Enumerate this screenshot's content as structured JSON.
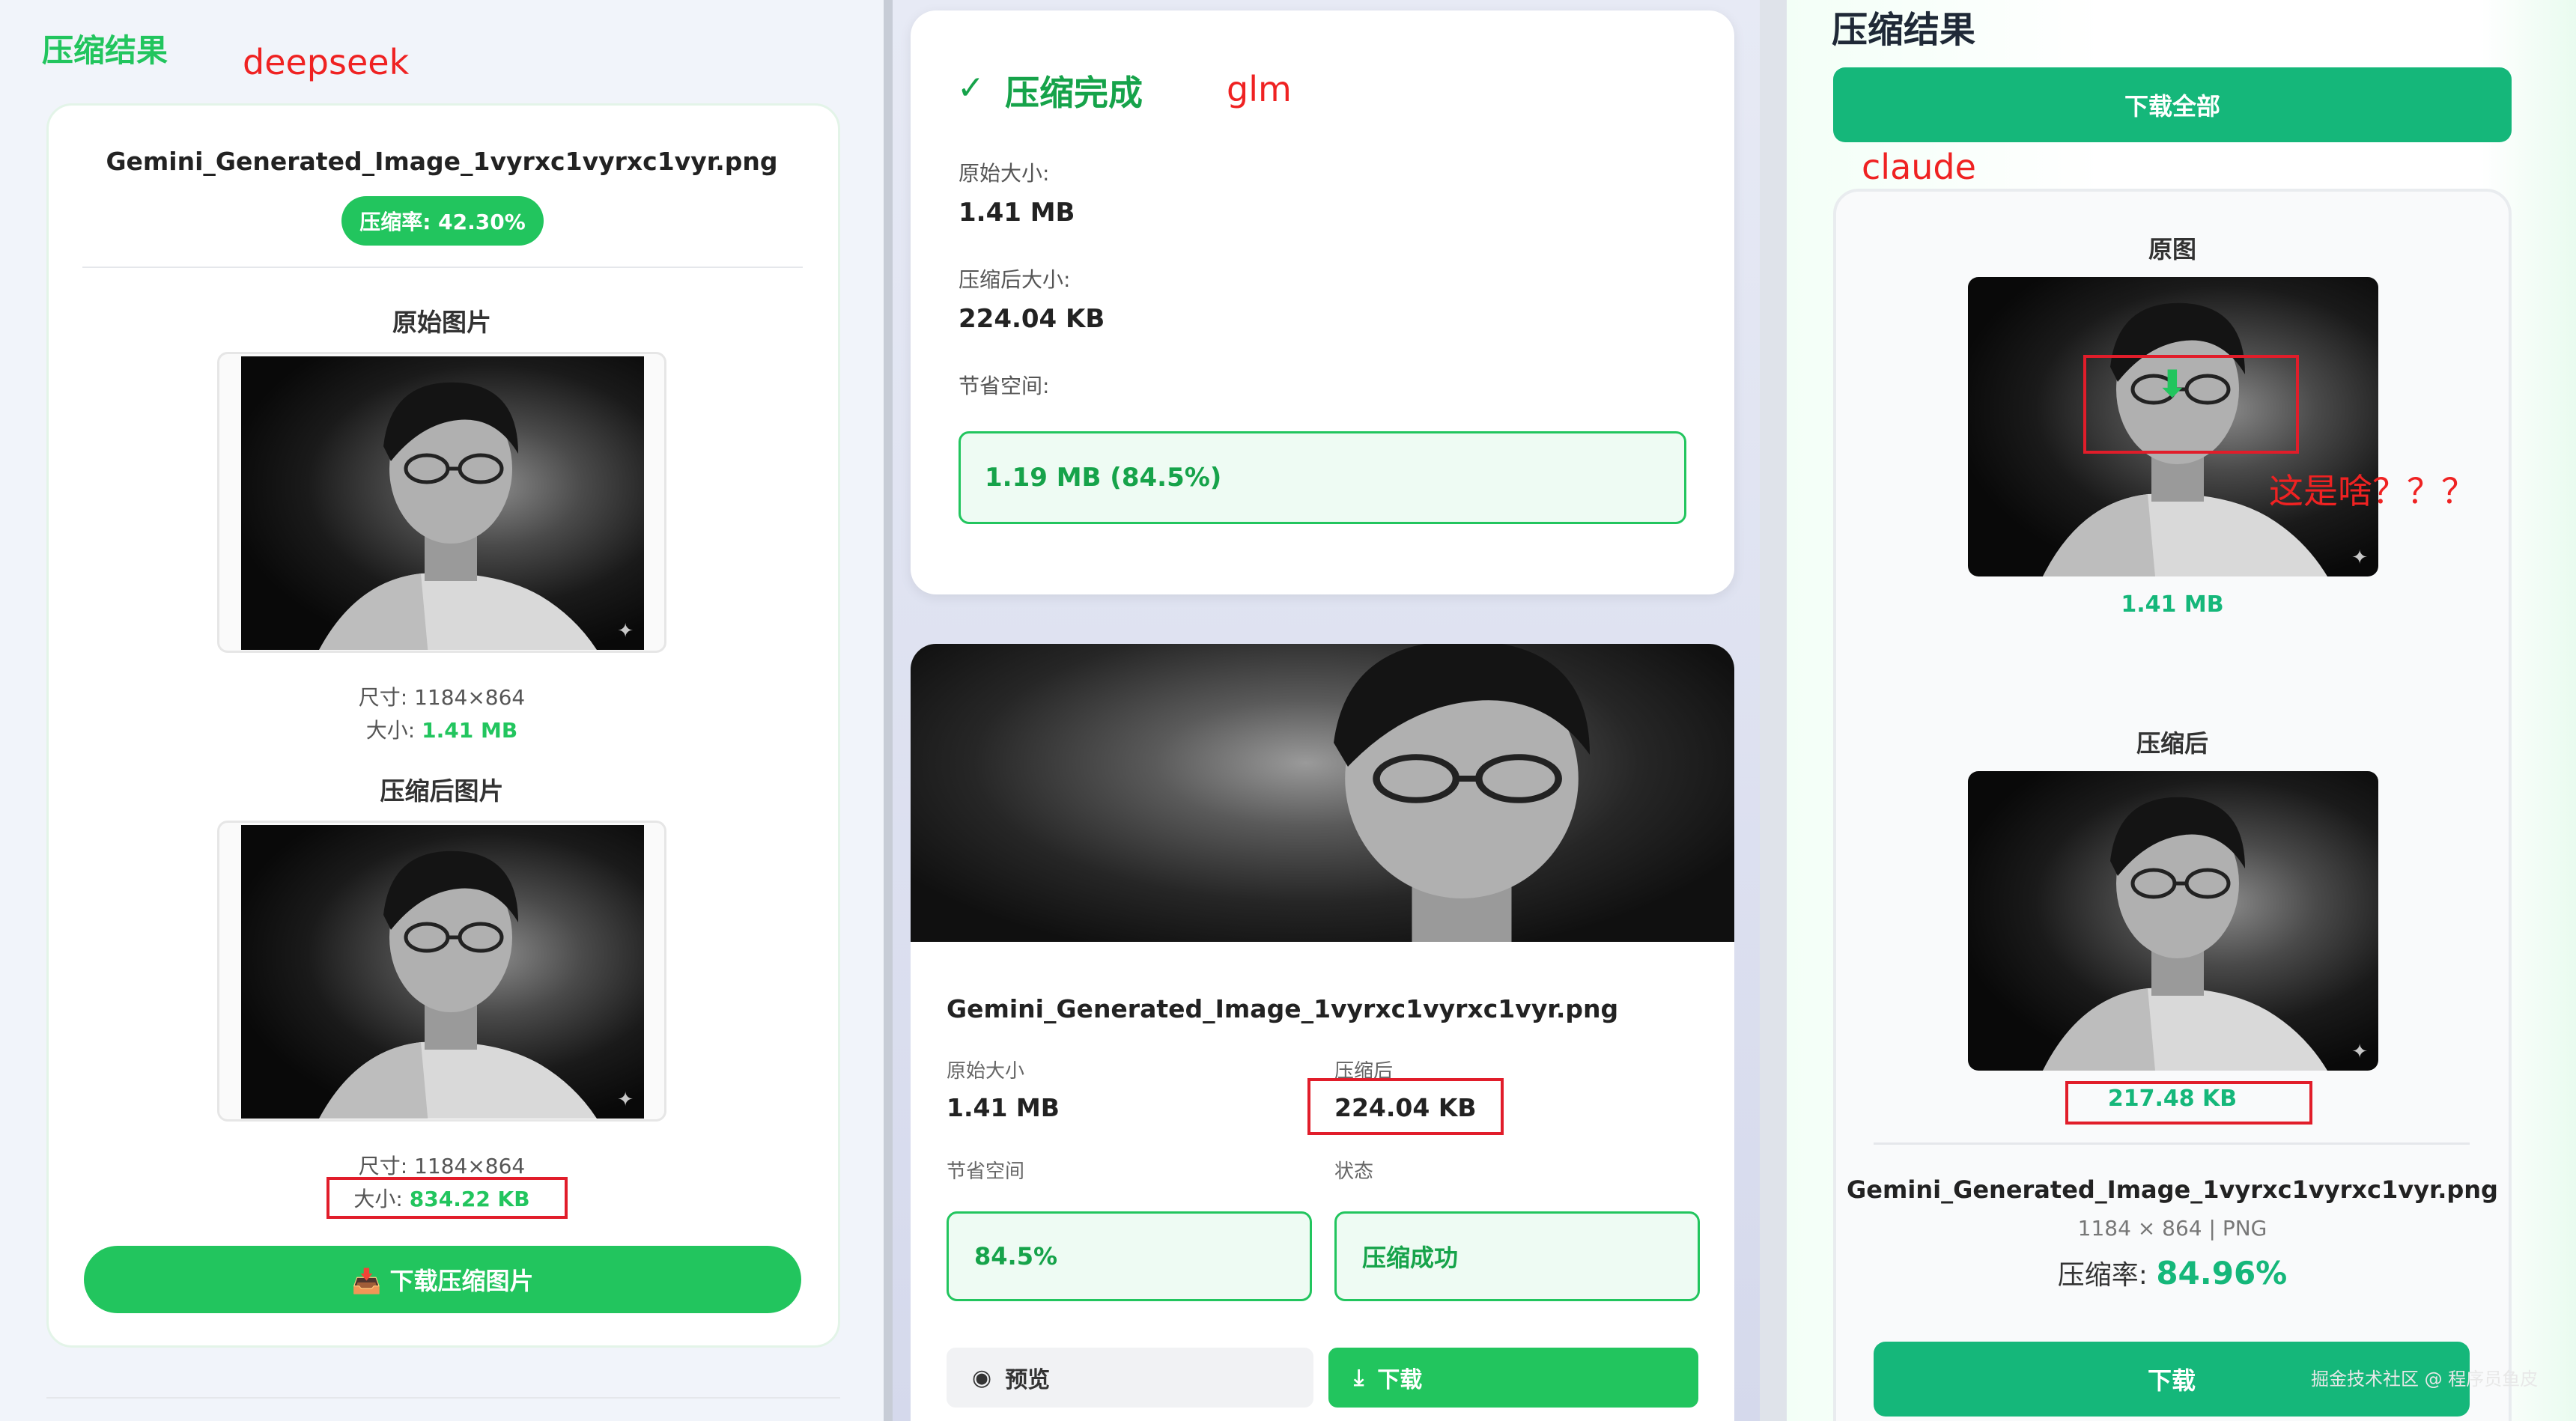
{
  "colors": {
    "accent": "#22c55e",
    "accent_dark": "#16a34a",
    "claude_green": "#15b77a",
    "annotation_red": "#e11d2a"
  },
  "deepseek": {
    "section_title": "压缩结果",
    "model_label": "deepseek",
    "filename": "Gemini_Generated_Image_1vyrxc1vyrxc1vyr.png",
    "ratio_badge": "压缩率: 42.30%",
    "original_heading": "原始图片",
    "original_dims": "尺寸: 1184×864",
    "original_size_label": "大小: ",
    "original_size_value": "1.41 MB",
    "compressed_heading": "压缩后图片",
    "compressed_dims": "尺寸: 1184×864",
    "compressed_size_label": "大小: ",
    "compressed_size_value": "834.22 KB",
    "download_label": "📥 下载压缩图片"
  },
  "glm": {
    "done_icon": "check-icon",
    "done_title": "压缩完成",
    "model_label": "glm",
    "original_label": "原始大小:",
    "original_value": "1.41 MB",
    "compressed_label": "压缩后大小:",
    "compressed_value": "224.04 KB",
    "saved_label": "节省空间:",
    "saved_value": "1.19 MB (84.5%)",
    "filename": "Gemini_Generated_Image_1vyrxc1vyrxc1vyr.png",
    "grid_original_label": "原始大小",
    "grid_original_value": "1.41 MB",
    "grid_compressed_label": "压缩后",
    "grid_compressed_value": "224.04 KB",
    "grid_saved_label": "节省空间",
    "grid_saved_value": "84.5%",
    "grid_status_label": "状态",
    "grid_status_value": "压缩成功",
    "preview_button": "预览",
    "download_button": "下载"
  },
  "claude": {
    "section_title": "压缩结果",
    "download_all": "下载全部",
    "model_label": "claude",
    "original_heading": "原图",
    "original_size": "1.41 MB",
    "annotation": "这是啥？？？",
    "compressed_heading": "压缩后",
    "compressed_size": "217.48 KB",
    "filename": "Gemini_Generated_Image_1vyrxc1vyrxc1vyr.png",
    "meta": "1184 × 864 | PNG",
    "ratio_label": "压缩率: ",
    "ratio_value": "84.96%",
    "download_button": "下载"
  },
  "watermark": "掘金技术社区 @ 程序员鱼皮"
}
